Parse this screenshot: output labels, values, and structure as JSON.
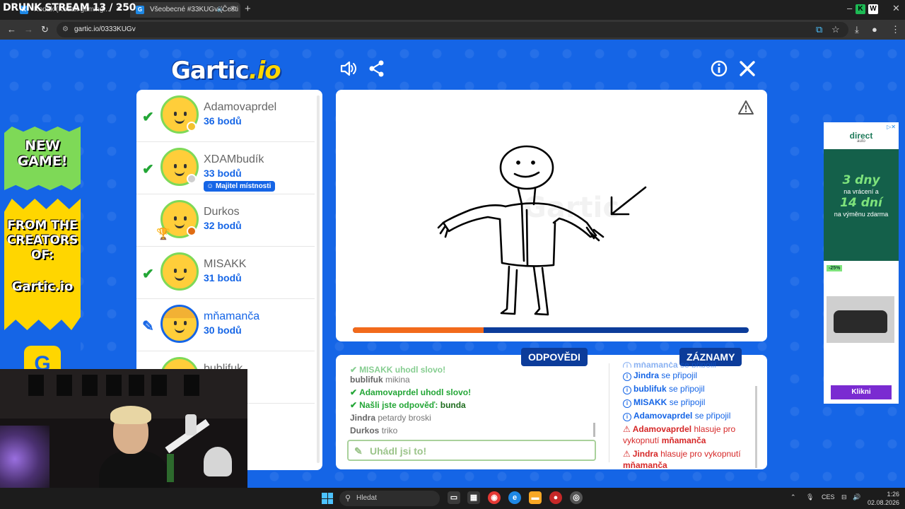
{
  "stream_overlay": "DRUNK STREAM 13 / 250",
  "browser": {
    "tabs": [
      {
        "label": "Kodak (Kodak gaming...",
        "active": false
      },
      {
        "label": "Všeobecné #33KUGv (Češti",
        "active": true
      }
    ],
    "url": "gartic.io/0333KUGv"
  },
  "game": {
    "logo_main": "Gartic",
    "logo_suffix": ".io",
    "players": [
      {
        "name": "Adamovaprdel",
        "points": "36 bodů",
        "status": "guessed",
        "dot_color": "#f2c12e"
      },
      {
        "name": "XDAMbudík",
        "points": "33 bodů",
        "status": "guessed",
        "dot_color": "#cfcfcf",
        "badge": "Majitel místnosti"
      },
      {
        "name": "Durkos",
        "points": "32 bodů",
        "status": "none",
        "dot_color": "#e06c12"
      },
      {
        "name": "MISAKK",
        "points": "31 bodů",
        "status": "guessed",
        "dot_color": ""
      },
      {
        "name": "mňamanča",
        "points": "30 bodů",
        "status": "drawing",
        "dot_color": ""
      },
      {
        "name": "bublifuk",
        "points": "",
        "status": "none",
        "dot_color": ""
      }
    ],
    "timer_progress": 0.33,
    "answers_tab": "ODPOVĚDI",
    "records_tab": "ZÁZNAMY",
    "answers": [
      {
        "type": "ok",
        "who": "MISAKK",
        "text": "uhodl slovo!",
        "faded": true
      },
      {
        "type": "guess",
        "who": "bublifuk",
        "text": "mikina"
      },
      {
        "type": "ok",
        "who": "Adamovaprdel",
        "text": "uhodl slovo!"
      },
      {
        "type": "found",
        "text": "Našli jste odpověď:",
        "word": "bunda"
      },
      {
        "type": "guess",
        "who": "Jindra",
        "text": "petardy broski"
      },
      {
        "type": "guess",
        "who": "Durkos",
        "text": "triko"
      }
    ],
    "answer_placeholder": "Uhádl jsi to!",
    "records": [
      {
        "type": "info",
        "who": "mňamanča",
        "text": "se připojil",
        "faded": true
      },
      {
        "type": "info",
        "who": "Jindra",
        "text": "se připojil"
      },
      {
        "type": "info",
        "who": "bublifuk",
        "text": "se připojil"
      },
      {
        "type": "info",
        "who": "MISAKK",
        "text": "se připojil"
      },
      {
        "type": "info",
        "who": "Adamovaprdel",
        "text": "se připojil"
      },
      {
        "type": "vote",
        "who": "Adamovaprdel",
        "text": "hlasuje pro vykopnutí",
        "target": "mňamanča"
      },
      {
        "type": "vote",
        "who": "Jindra",
        "text": "hlasuje pro vykopnutí",
        "target": "mňamanča"
      }
    ]
  },
  "left_ad": {
    "line1": "NEW GAME!",
    "line2": "FROM THE CREATORS OF:",
    "brand": "Gartic.io"
  },
  "right_ad": {
    "brand": "direct",
    "brand_sub": "auto",
    "big1": "3 dny",
    "small1": "na vrácení a",
    "big2": "14 dní",
    "small2": "na výměnu zdarma",
    "discount": "-25%",
    "cta": "Klikni"
  },
  "taskbar": {
    "search_placeholder": "Hledat",
    "lang": "CES",
    "time": "1:26",
    "date": "02.08.2026"
  },
  "colors": {
    "game_blue": "#1565e6",
    "dark_blue": "#0c3c9a",
    "guess_green": "#23a636",
    "vote_red": "#d62828",
    "timer_orange": "#f26a1b"
  }
}
